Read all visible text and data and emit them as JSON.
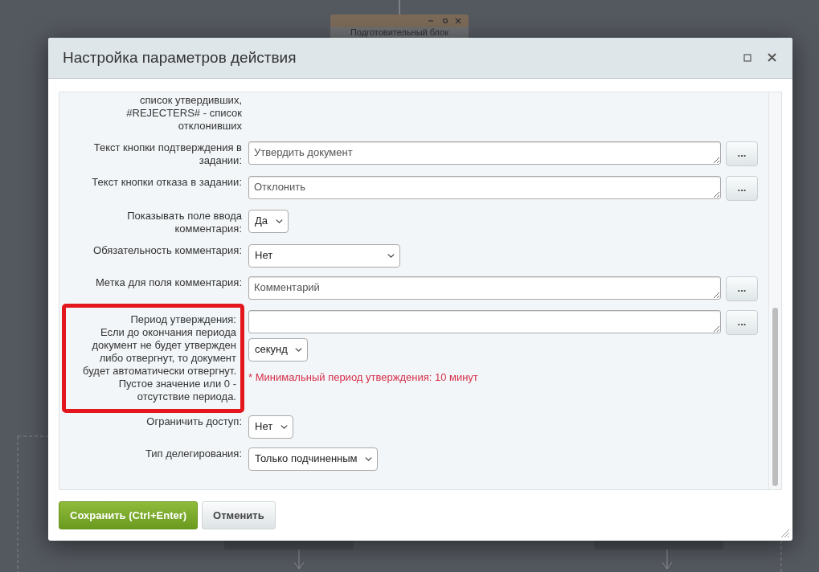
{
  "background": {
    "node_title": "Подготовительный блок"
  },
  "dialog": {
    "title": "Настройка параметров действия"
  },
  "fields": [
    {
      "kind": "note",
      "label": "список утвердивших, #REJECTERS# - список отклонивших",
      "highlighted": false
    },
    {
      "kind": "textarea",
      "label": "Текст кнопки подтверждения в задании:",
      "value": "Утвердить документ",
      "picker": "...",
      "highlighted": false
    },
    {
      "kind": "textarea",
      "label": "Текст кнопки отказа в задании:",
      "value": "Отклонить",
      "picker": "...",
      "highlighted": false
    },
    {
      "kind": "select",
      "label": "Показывать поле ввода комментария:",
      "value": "Да",
      "highlighted": false
    },
    {
      "kind": "select",
      "label": "Обязательность комментария:",
      "value": "Нет",
      "highlighted": false
    },
    {
      "kind": "textarea",
      "label": "Метка для поля комментария:",
      "value": "Комментарий",
      "picker": "...",
      "highlighted": false
    },
    {
      "kind": "period",
      "label": "Период утверждения:",
      "description": "Если до окончания периода документ не будет утвержден либо отвергнут, то документ будет автоматически отвергнут. Пустое значение или 0 - отсутствие периода.",
      "picker": "...",
      "unit": "секунд",
      "hint": "* Минимальный период утверждения: 10 минут",
      "highlighted": true
    },
    {
      "kind": "select",
      "label": "Ограничить доступ:",
      "value": "Нет",
      "highlighted": false
    },
    {
      "kind": "select",
      "label": "Тип делегирования:",
      "value": "Только подчиненным",
      "highlighted": false
    }
  ],
  "buttons": [
    {
      "label": "Сохранить (Ctrl+Enter)",
      "kind": "primary"
    },
    {
      "label": "Отменить",
      "kind": "secondary"
    }
  ]
}
